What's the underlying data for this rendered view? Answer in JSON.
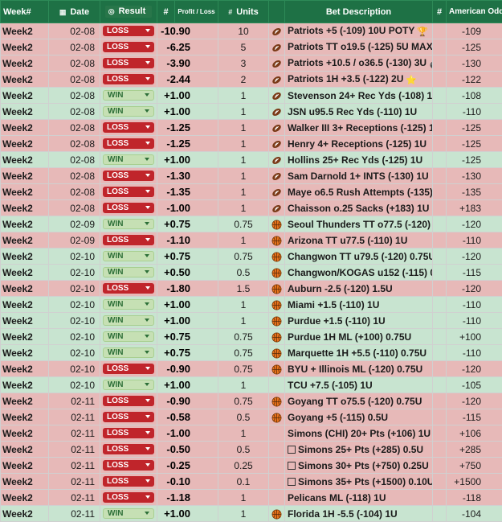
{
  "header": {
    "week": "Week#",
    "date": "Date",
    "result": "Result",
    "num": "#",
    "pl": "Profit / Loss",
    "units": "Units",
    "bet": "Bet Description",
    "num2": "#",
    "odds": "American Odds"
  },
  "colors": {
    "header_bg": "#1e7145",
    "loss_row": "#e7b9b8",
    "win_row": "#c8e4d0",
    "loss_pill": "#c0252b",
    "win_pill": "#c6e0b4"
  },
  "rows": [
    {
      "week": "Week2",
      "date": "02-08",
      "result": "LOSS",
      "pl": "-10.90",
      "units": "10",
      "sport": "football-icon",
      "desc": "Patriots +5 (-109) 10U POTY",
      "emoji": "🏆",
      "odds": "-109"
    },
    {
      "week": "Week2",
      "date": "02-08",
      "result": "LOSS",
      "pl": "-6.25",
      "units": "5",
      "sport": "football-icon",
      "desc": "Patriots TT o19.5 (-125) 5U MAX",
      "emoji": "💎",
      "odds": "-125"
    },
    {
      "week": "Week2",
      "date": "02-08",
      "result": "LOSS",
      "pl": "-3.90",
      "units": "3",
      "sport": "football-icon",
      "desc": "Patriots +10.5 / o36.5 (-130) 3U",
      "emoji": "💣",
      "odds": "-130"
    },
    {
      "week": "Week2",
      "date": "02-08",
      "result": "LOSS",
      "pl": "-2.44",
      "units": "2",
      "sport": "football-icon",
      "desc": "Patriots 1H +3.5 (-122) 2U",
      "emoji": "⭐",
      "odds": "-122"
    },
    {
      "week": "Week2",
      "date": "02-08",
      "result": "WIN",
      "pl": "+1.00",
      "units": "1",
      "sport": "football-icon",
      "desc": "Stevenson 24+ Rec Yds (-108) 1U",
      "emoji": "",
      "odds": "-108"
    },
    {
      "week": "Week2",
      "date": "02-08",
      "result": "WIN",
      "pl": "+1.00",
      "units": "1",
      "sport": "football-icon",
      "desc": "JSN u95.5 Rec Yds (-110) 1U",
      "emoji": "",
      "odds": "-110"
    },
    {
      "week": "Week2",
      "date": "02-08",
      "result": "LOSS",
      "pl": "-1.25",
      "units": "1",
      "sport": "football-icon",
      "desc": "Walker III 3+ Receptions (-125) 1U",
      "emoji": "",
      "odds": "-125"
    },
    {
      "week": "Week2",
      "date": "02-08",
      "result": "LOSS",
      "pl": "-1.25",
      "units": "1",
      "sport": "football-icon",
      "desc": "Henry 4+ Receptions (-125) 1U",
      "emoji": "",
      "odds": "-125"
    },
    {
      "week": "Week2",
      "date": "02-08",
      "result": "WIN",
      "pl": "+1.00",
      "units": "1",
      "sport": "football-icon",
      "desc": "Hollins 25+ Rec Yds (-125) 1U",
      "emoji": "",
      "odds": "-125"
    },
    {
      "week": "Week2",
      "date": "02-08",
      "result": "LOSS",
      "pl": "-1.30",
      "units": "1",
      "sport": "football-icon",
      "desc": "Sam Darnold 1+ INTS (-130) 1U",
      "emoji": "",
      "odds": "-130"
    },
    {
      "week": "Week2",
      "date": "02-08",
      "result": "LOSS",
      "pl": "-1.35",
      "units": "1",
      "sport": "football-icon",
      "desc": "Maye o6.5 Rush Attempts (-135) 1U",
      "emoji": "",
      "odds": "-135"
    },
    {
      "week": "Week2",
      "date": "02-08",
      "result": "LOSS",
      "pl": "-1.00",
      "units": "1",
      "sport": "football-icon",
      "desc": "Chaisson o.25 Sacks (+183) 1U",
      "emoji": "",
      "odds": "+183"
    },
    {
      "week": "Week2",
      "date": "02-09",
      "result": "WIN",
      "pl": "+0.75",
      "units": "0.75",
      "sport": "basketball-icon",
      "desc": "Seoul Thunders TT o77.5 (-120) 0.75U",
      "emoji": "",
      "odds": "-120"
    },
    {
      "week": "Week2",
      "date": "02-09",
      "result": "LOSS",
      "pl": "-1.10",
      "units": "1",
      "sport": "basketball-icon",
      "desc": "Arizona TT u77.5 (-110) 1U",
      "emoji": "",
      "odds": "-110"
    },
    {
      "week": "Week2",
      "date": "02-10",
      "result": "WIN",
      "pl": "+0.75",
      "units": "0.75",
      "sport": "basketball-icon",
      "desc": "Changwon TT u79.5 (-120) 0.75U",
      "emoji": "",
      "odds": "-120"
    },
    {
      "week": "Week2",
      "date": "02-10",
      "result": "WIN",
      "pl": "+0.50",
      "units": "0.5",
      "sport": "basketball-icon",
      "desc": "Changwon/KOGAS u152 (-115) 0.5U",
      "emoji": "",
      "odds": "-115"
    },
    {
      "week": "Week2",
      "date": "02-10",
      "result": "LOSS",
      "pl": "-1.80",
      "units": "1.5",
      "sport": "basketball-icon",
      "desc": "Auburn -2.5 (-120) 1.5U",
      "emoji": "",
      "odds": "-120"
    },
    {
      "week": "Week2",
      "date": "02-10",
      "result": "WIN",
      "pl": "+1.00",
      "units": "1",
      "sport": "basketball-icon",
      "desc": "Miami +1.5 (-110) 1U",
      "emoji": "",
      "odds": "-110"
    },
    {
      "week": "Week2",
      "date": "02-10",
      "result": "WIN",
      "pl": "+1.00",
      "units": "1",
      "sport": "basketball-icon",
      "desc": "Purdue +1.5 (-110) 1U",
      "emoji": "",
      "odds": "-110"
    },
    {
      "week": "Week2",
      "date": "02-10",
      "result": "WIN",
      "pl": "+0.75",
      "units": "0.75",
      "sport": "basketball-icon",
      "desc": "Purdue 1H ML (+100) 0.75U",
      "emoji": "",
      "odds": "+100"
    },
    {
      "week": "Week2",
      "date": "02-10",
      "result": "WIN",
      "pl": "+0.75",
      "units": "0.75",
      "sport": "basketball-icon",
      "desc": "Marquette 1H +5.5 (-110) 0.75U",
      "emoji": "",
      "odds": "-110"
    },
    {
      "week": "Week2",
      "date": "02-10",
      "result": "LOSS",
      "pl": "-0.90",
      "units": "0.75",
      "sport": "basketball-icon",
      "desc": "BYU + Illinois ML (-120) 0.75U",
      "emoji": "",
      "odds": "-120"
    },
    {
      "week": "Week2",
      "date": "02-10",
      "result": "WIN",
      "pl": "+1.00",
      "units": "1",
      "sport": "",
      "desc": "TCU +7.5 (-105) 1U",
      "emoji": "",
      "odds": "-105"
    },
    {
      "week": "Week2",
      "date": "02-11",
      "result": "LOSS",
      "pl": "-0.90",
      "units": "0.75",
      "sport": "basketball-icon",
      "desc": "Goyang TT o75.5 (-120) 0.75U",
      "emoji": "",
      "odds": "-120"
    },
    {
      "week": "Week2",
      "date": "02-11",
      "result": "LOSS",
      "pl": "-0.58",
      "units": "0.5",
      "sport": "basketball-icon",
      "desc": "Goyang +5 (-115) 0.5U",
      "emoji": "",
      "odds": "-115"
    },
    {
      "week": "Week2",
      "date": "02-11",
      "result": "LOSS",
      "pl": "-1.00",
      "units": "1",
      "sport": "",
      "desc": "Simons (CHI) 20+ Pts (+106) 1U",
      "emoji": "",
      "odds": "+106"
    },
    {
      "week": "Week2",
      "date": "02-11",
      "result": "LOSS",
      "pl": "-0.50",
      "units": "0.5",
      "sport": "box-icon",
      "desc": "Simons 25+ Pts (+285) 0.5U",
      "emoji": "",
      "odds": "+285"
    },
    {
      "week": "Week2",
      "date": "02-11",
      "result": "LOSS",
      "pl": "-0.25",
      "units": "0.25",
      "sport": "box-icon",
      "desc": "Simons 30+ Pts (+750) 0.25U",
      "emoji": "",
      "odds": "+750"
    },
    {
      "week": "Week2",
      "date": "02-11",
      "result": "LOSS",
      "pl": "-0.10",
      "units": "0.1",
      "sport": "box-icon",
      "desc": "Simons 35+ Pts (+1500) 0.10U",
      "emoji": "",
      "odds": "+1500"
    },
    {
      "week": "Week2",
      "date": "02-11",
      "result": "LOSS",
      "pl": "-1.18",
      "units": "1",
      "sport": "",
      "desc": "Pelicans ML (-118) 1U",
      "emoji": "",
      "odds": "-118"
    },
    {
      "week": "Week2",
      "date": "02-11",
      "result": "WIN",
      "pl": "+1.00",
      "units": "1",
      "sport": "basketball-icon",
      "desc": "Florida 1H -5.5 (-104) 1U",
      "emoji": "",
      "odds": "-104"
    }
  ]
}
